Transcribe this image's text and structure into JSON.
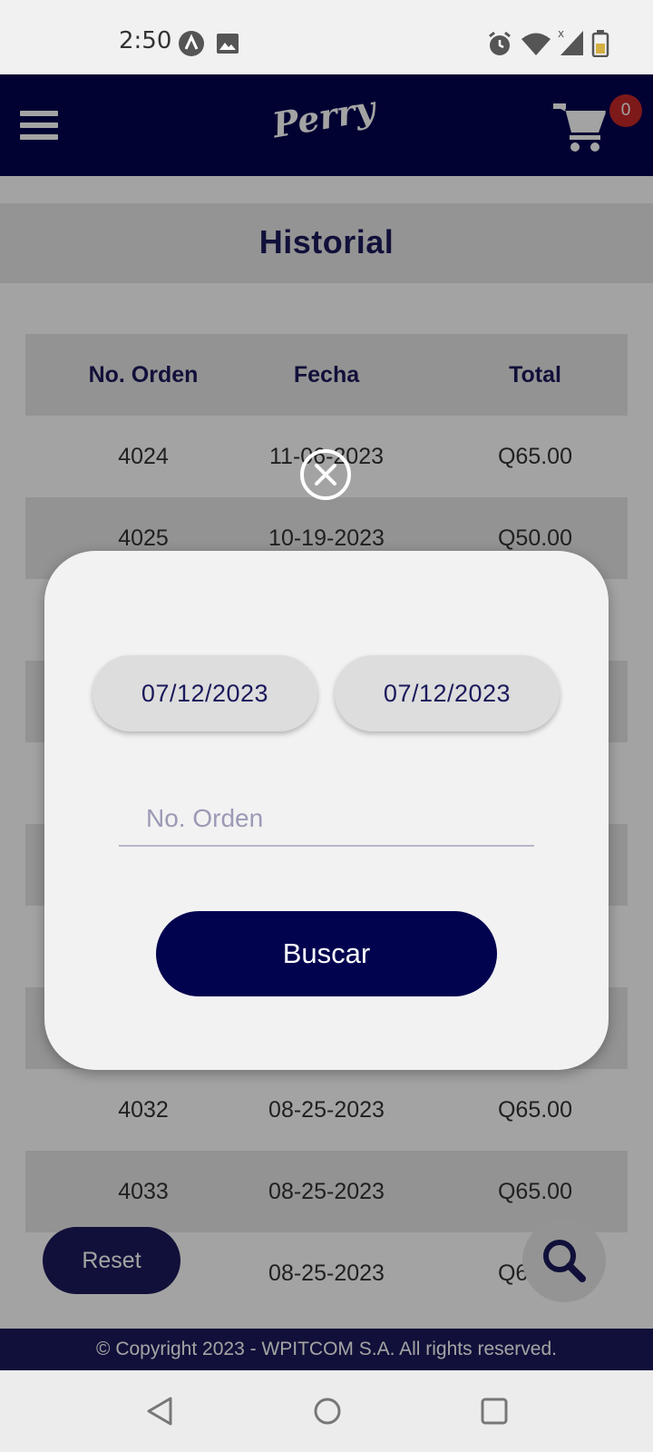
{
  "status_bar": {
    "time": "2:50"
  },
  "header": {
    "logo": "Perry",
    "cart_count": "0"
  },
  "page": {
    "title": "Historial"
  },
  "table": {
    "headers": [
      "No. Orden",
      "Fecha",
      "Total"
    ],
    "rows": [
      [
        "4024",
        "11-06-2023",
        "Q65.00"
      ],
      [
        "4025",
        "10-19-2023",
        "Q50.00"
      ],
      [
        "4032",
        "08-25-2023",
        "Q65.00"
      ],
      [
        "4033",
        "08-25-2023",
        "Q65.00"
      ],
      [
        "",
        "08-25-2023",
        "Q65.00"
      ]
    ]
  },
  "buttons": {
    "reset": "Reset"
  },
  "footer": {
    "copyright": "© Copyright 2023 - WPITCOM S.A. All rights reserved."
  },
  "modal": {
    "date_from": "07/12/2023",
    "date_to": "07/12/2023",
    "order_placeholder": "No. Orden",
    "search_label": "Buscar"
  },
  "icons": {
    "menu": "hamburger-menu-icon",
    "cart": "shopping-cart-icon",
    "search": "magnifier-icon",
    "close": "close-circle-icon"
  },
  "colors": {
    "brand_navy": "#02034f",
    "badge_red": "#c62828",
    "accent": "#1b1a5c"
  }
}
